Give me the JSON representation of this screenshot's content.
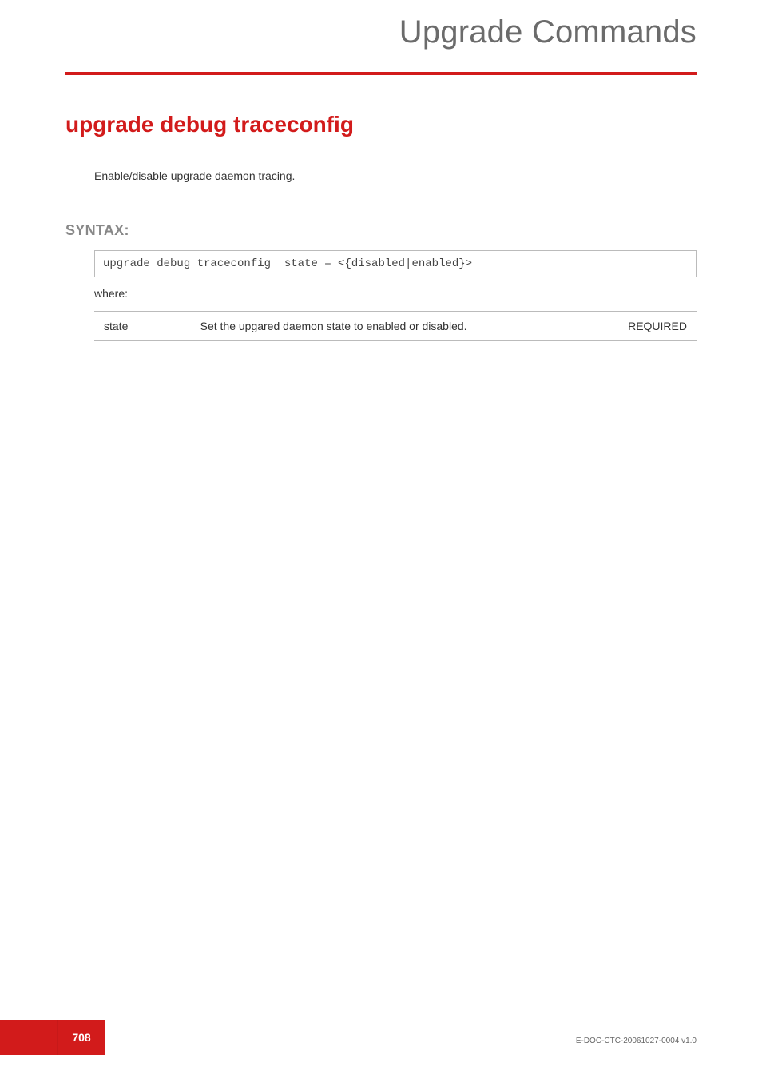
{
  "header": {
    "title": "Upgrade Commands"
  },
  "section": {
    "title": "upgrade debug traceconfig",
    "description": "Enable/disable upgrade daemon tracing."
  },
  "syntax": {
    "heading": "SYNTAX:",
    "command": "upgrade debug traceconfig  state = <{disabled|enabled}>",
    "where_label": "where:"
  },
  "params": [
    {
      "name": "state",
      "desc": "Set the upgared daemon state to enabled or disabled.",
      "flag": "REQUIRED"
    }
  ],
  "footer": {
    "page_number": "708",
    "doc_code": "E-DOC-CTC-20061027-0004 v1.0"
  }
}
